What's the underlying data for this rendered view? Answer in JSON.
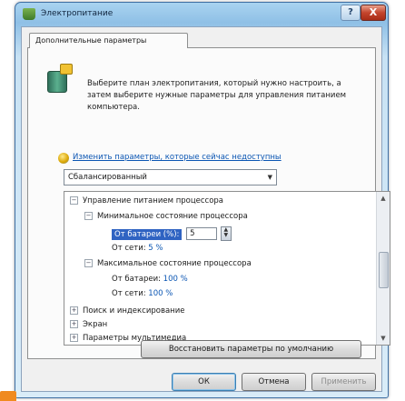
{
  "window": {
    "title": "Электропитание",
    "help_label": "?",
    "close_label": "X"
  },
  "tab": {
    "label": "Дополнительные параметры"
  },
  "description": "Выберите план электропитания, который нужно настроить, а затем выберите нужные параметры для управления питанием компьютера.",
  "link_text": "Изменить параметры, которые сейчас недоступны",
  "plan_select": {
    "value": "Сбалансированный"
  },
  "tree": {
    "group1": "Управление питанием процессора",
    "group1_child": "Минимальное состояние процессора",
    "battery_label": "От батареи (%):",
    "battery_value": "5",
    "mains_label": "От сети:",
    "mains_value": "5 %",
    "group2": "Максимальное состояние процессора",
    "g2_battery_label": "От батареи:",
    "g2_battery_value": "100 %",
    "g2_mains_label": "От сети:",
    "g2_mains_value": "100 %",
    "item_pci": "Поиск и индексирование",
    "item_screen": "Экран",
    "item_multimedia": "Параметры мультимедиа",
    "expand_minus": "−",
    "expand_plus": "+"
  },
  "buttons": {
    "restore": "Восстановить параметры по умолчанию",
    "ok": "ОК",
    "cancel": "Отмена",
    "apply": "Применить"
  },
  "icons": {
    "title": "power-options-icon",
    "plan": "battery-plug-icon",
    "shield": "shield-icon"
  },
  "colors": {
    "selection": "#2f63c2",
    "link": "#0b56b3",
    "accent_orange": "#f08a1f"
  }
}
